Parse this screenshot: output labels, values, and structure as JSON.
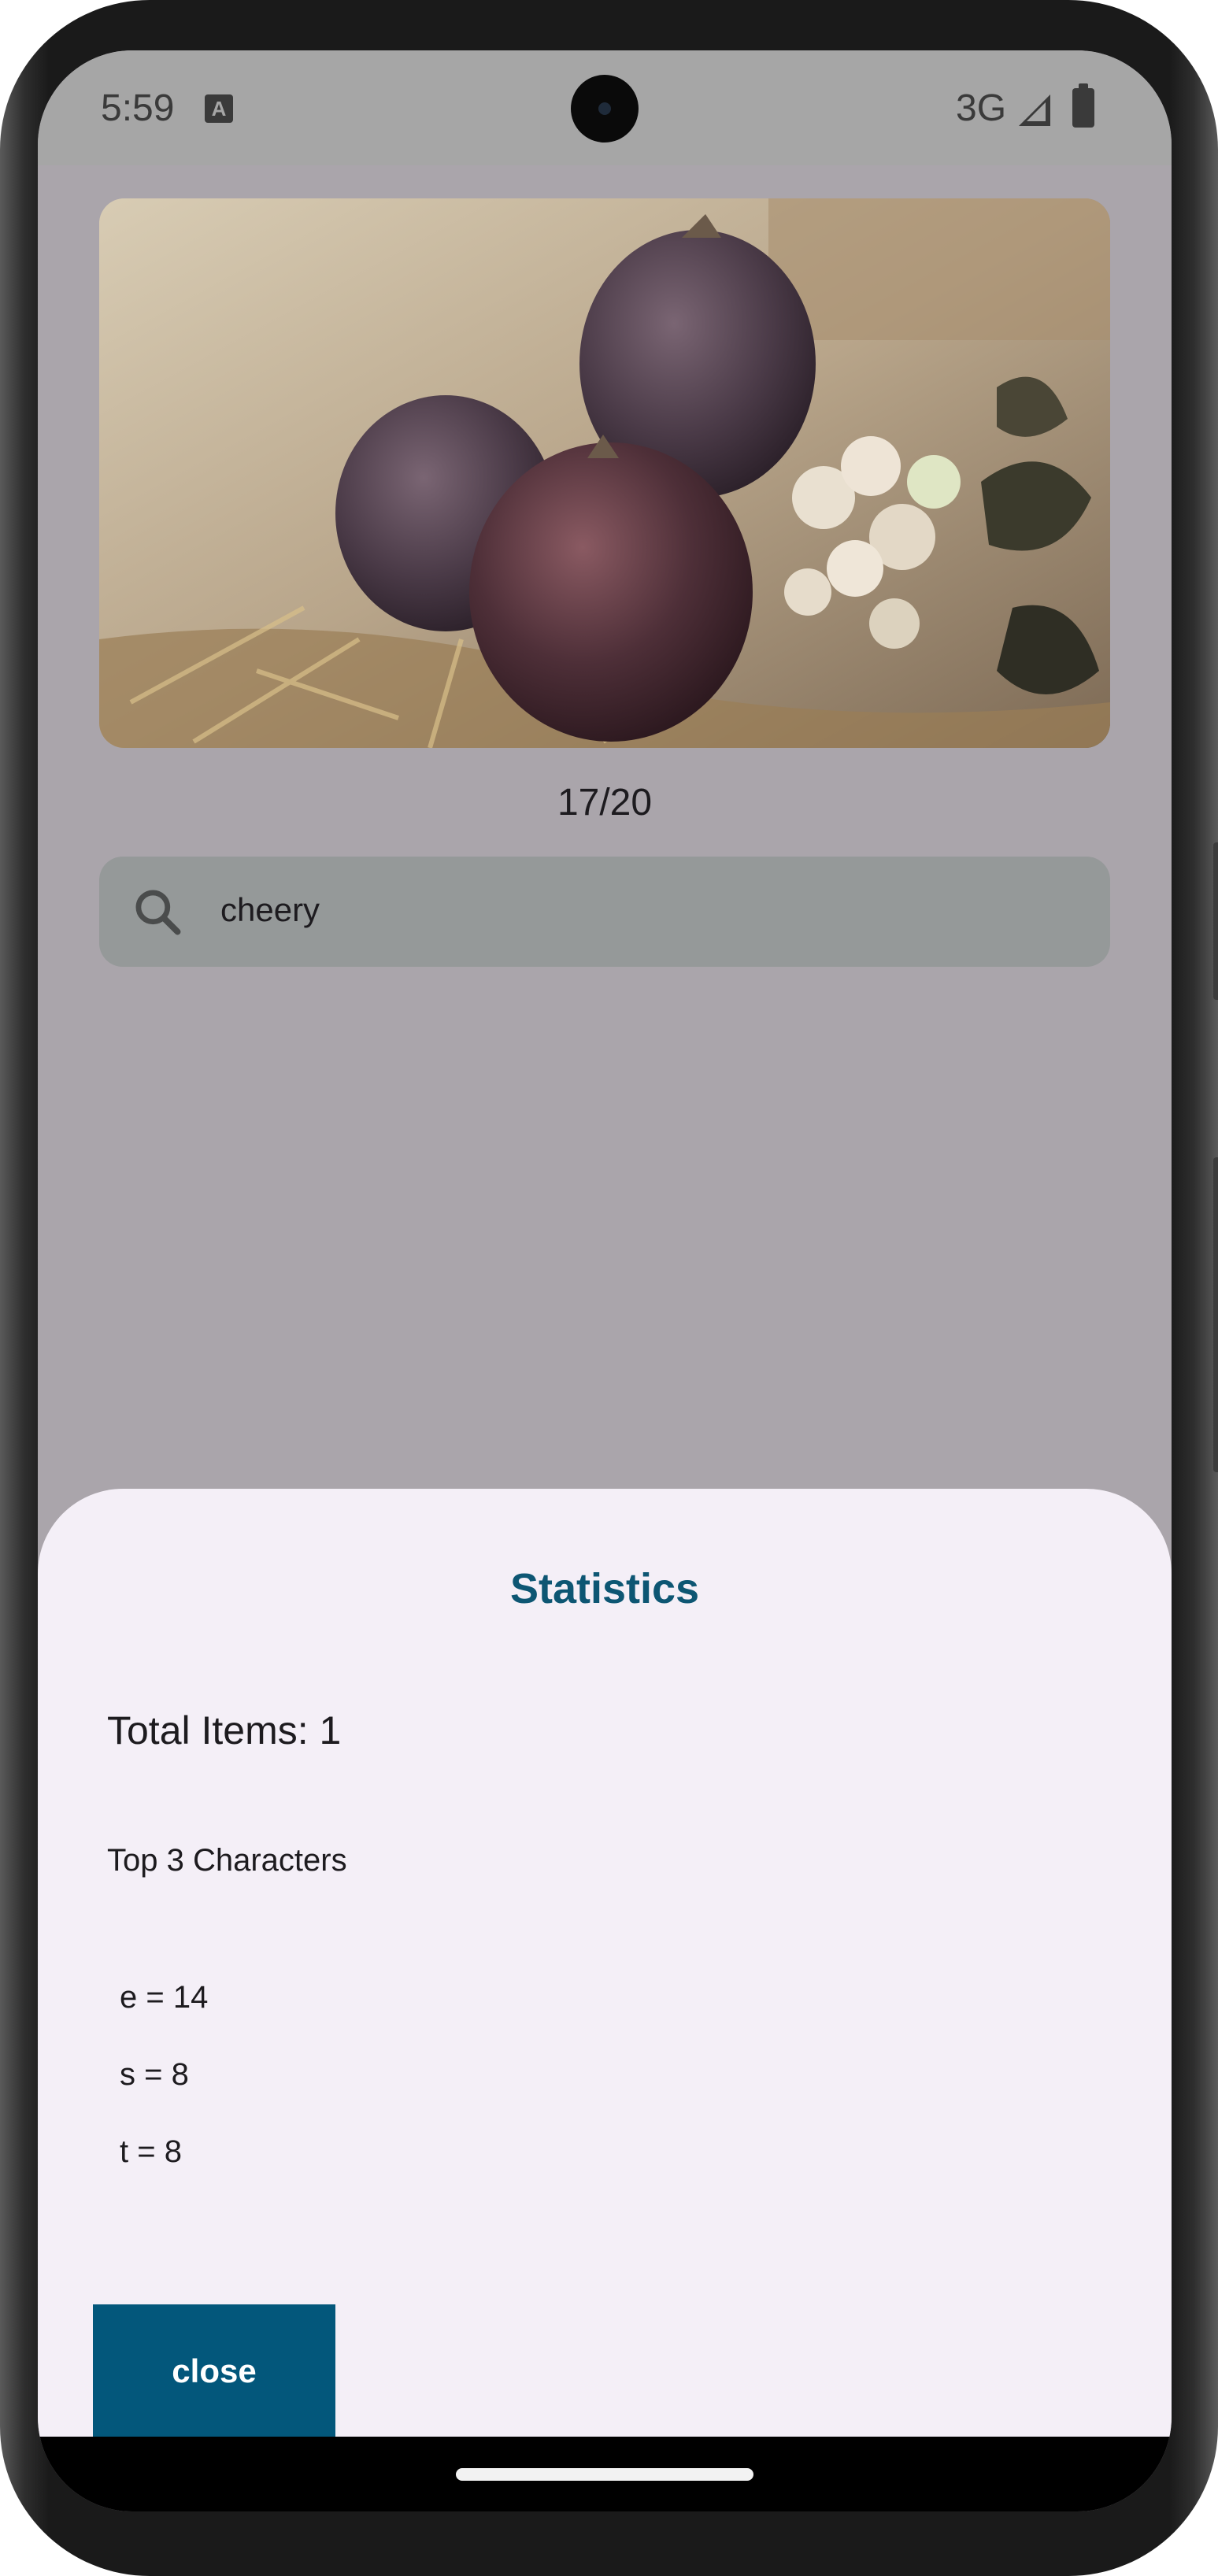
{
  "status_bar": {
    "time": "5:59",
    "network": "3G",
    "keyboard_badge": "A"
  },
  "gallery": {
    "counter": "17/20"
  },
  "search": {
    "value": "cheery"
  },
  "statistics_sheet": {
    "title": "Statistics",
    "total_items": "Total Items: 1",
    "top_chars_heading": "Top 3 Characters",
    "top_chars": [
      "e = 14",
      "s = 8",
      "t = 8"
    ],
    "close_label": "close"
  },
  "colors": {
    "accent": "#03577b",
    "title": "#0d5673",
    "sheet_bg": "#f4eff7",
    "scrim_bg": "#aaa5ab",
    "search_bg": "#959999"
  }
}
